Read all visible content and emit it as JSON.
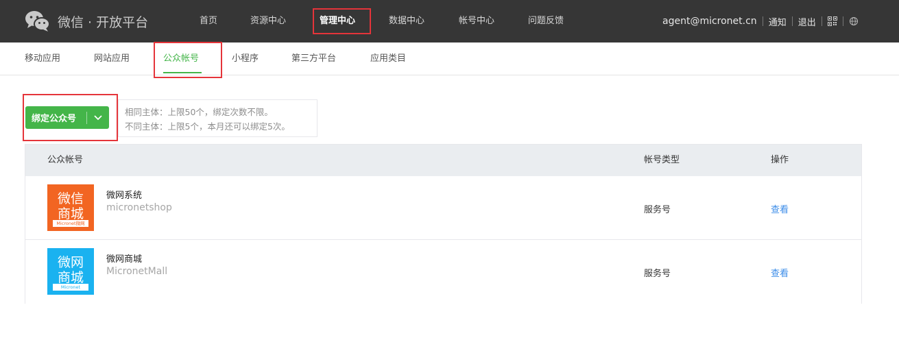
{
  "header": {
    "logo_text": "微信 · 开放平台",
    "nav": [
      {
        "label": "首页"
      },
      {
        "label": "资源中心"
      },
      {
        "label": "管理中心"
      },
      {
        "label": "数据中心"
      },
      {
        "label": "帐号中心"
      },
      {
        "label": "问题反馈"
      }
    ],
    "email": "agent@micronet.cn",
    "notify": "通知",
    "logout": "退出"
  },
  "subnav": [
    {
      "label": "移动应用"
    },
    {
      "label": "网站应用"
    },
    {
      "label": "公众帐号"
    },
    {
      "label": "小程序"
    },
    {
      "label": "第三方平台"
    },
    {
      "label": "应用类目"
    }
  ],
  "bind": {
    "label": "绑定公众号",
    "tip_line1": "相同主体：上限50个，绑定次数不限。",
    "tip_line2": "不同主体：上限5个，本月还可以绑定5次。"
  },
  "table": {
    "headers": {
      "account": "公众帐号",
      "type": "帐号类型",
      "op": "操作"
    },
    "rows": [
      {
        "avatar_line1": "微信",
        "avatar_line2": "商城",
        "avatar_sub": "Micronet微网",
        "name": "微网系统",
        "id": "micronetshop",
        "type": "服务号",
        "op": "查看",
        "color": "#f26522"
      },
      {
        "avatar_line1": "微网",
        "avatar_line2": "商城",
        "avatar_sub": "Micronet",
        "name": "微网商城",
        "id": "MicronetMall",
        "type": "服务号",
        "op": "查看",
        "color": "#1ab2f0"
      }
    ]
  },
  "colors": {
    "accent": "#44b549",
    "link": "#3b8ce8",
    "highlight": "#e5343a"
  }
}
